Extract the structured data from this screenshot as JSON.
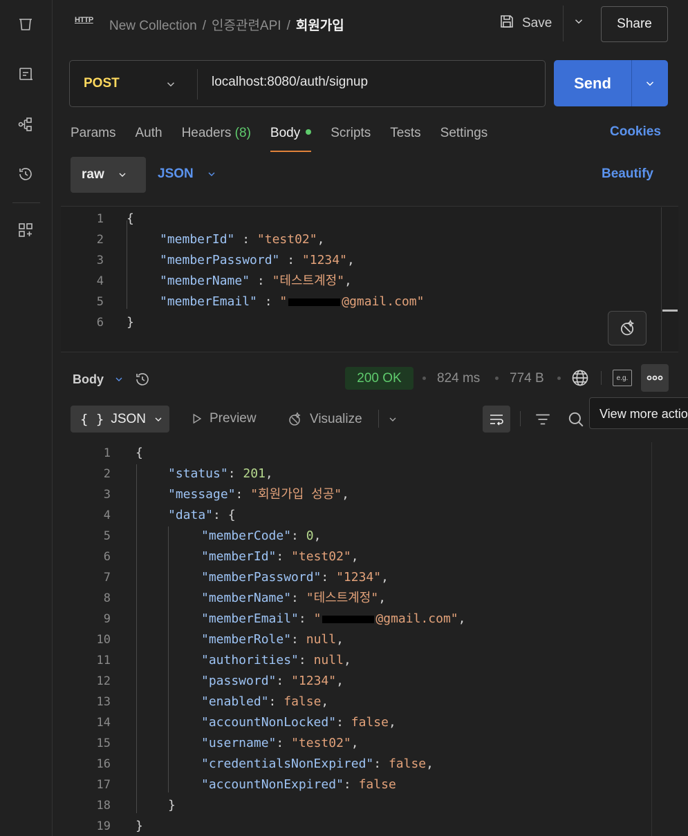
{
  "header": {
    "badge": "HTTP",
    "breadcrumb": [
      "New Collection",
      "인증관련API",
      "회원가입"
    ],
    "crumb_sep": "/",
    "save_label": "Save",
    "share_label": "Share"
  },
  "request": {
    "method": "POST",
    "url": "localhost:8080/auth/signup",
    "send_label": "Send"
  },
  "tabs": {
    "params": "Params",
    "auth": "Auth",
    "headers": "Headers",
    "headers_count": "(8)",
    "body": "Body",
    "scripts": "Scripts",
    "tests": "Tests",
    "settings": "Settings",
    "cookies": "Cookies"
  },
  "body_mode": {
    "raw": "raw",
    "json": "JSON",
    "beautify": "Beautify"
  },
  "request_body": {
    "line_numbers": [
      "1",
      "2",
      "3",
      "4",
      "5",
      "6"
    ],
    "open": "{",
    "close": "}",
    "fields": [
      {
        "key": "\"memberId\"",
        "value": "\"test02\"",
        "comma": ","
      },
      {
        "key": "\"memberPassword\"",
        "value": "\"1234\"",
        "comma": ","
      },
      {
        "key": "\"memberName\"",
        "value": "\"테스트계정\"",
        "comma": ","
      }
    ],
    "email_key": "\"memberEmail\"",
    "email_prefix": "\"",
    "email_suffix": "@gmail.com\""
  },
  "response": {
    "body_label": "Body",
    "status": "200 OK",
    "time": "824 ms",
    "size": "774 B",
    "eg_label": "e.g.",
    "tooltip": "View more actions",
    "format_label": "JSON",
    "format_braces": "{ }",
    "preview_label": "Preview",
    "visualize_label": "Visualize"
  },
  "response_body": {
    "line_numbers": [
      "1",
      "2",
      "3",
      "4",
      "5",
      "6",
      "7",
      "8",
      "9",
      "10",
      "11",
      "12",
      "13",
      "14",
      "15",
      "16",
      "17",
      "18",
      "19"
    ],
    "open": "{",
    "close": "}",
    "status_key": "\"status\"",
    "status_val": "201",
    "message_key": "\"message\"",
    "message_val": "\"회원가입 성공\"",
    "data_key": "\"data\"",
    "data_fields": [
      {
        "key": "\"memberCode\"",
        "value": "0",
        "type": "num",
        "comma": ","
      },
      {
        "key": "\"memberId\"",
        "value": "\"test02\"",
        "type": "str",
        "comma": ","
      },
      {
        "key": "\"memberPassword\"",
        "value": "\"1234\"",
        "type": "str",
        "comma": ","
      },
      {
        "key": "\"memberName\"",
        "value": "\"테스트계정\"",
        "type": "str",
        "comma": ","
      },
      {
        "key": "\"memberEmail\"",
        "value": "EMAIL",
        "type": "email",
        "comma": ","
      },
      {
        "key": "\"memberRole\"",
        "value": "null",
        "type": "lit",
        "comma": ","
      },
      {
        "key": "\"authorities\"",
        "value": "null",
        "type": "lit",
        "comma": ","
      },
      {
        "key": "\"password\"",
        "value": "\"1234\"",
        "type": "str",
        "comma": ","
      },
      {
        "key": "\"enabled\"",
        "value": "false",
        "type": "lit",
        "comma": ","
      },
      {
        "key": "\"accountNonLocked\"",
        "value": "false",
        "type": "lit",
        "comma": ","
      },
      {
        "key": "\"username\"",
        "value": "\"test02\"",
        "type": "str",
        "comma": ","
      },
      {
        "key": "\"credentialsNonExpired\"",
        "value": "false",
        "type": "lit",
        "comma": ","
      },
      {
        "key": "\"accountNonExpired\"",
        "value": "false",
        "type": "lit",
        "comma": ""
      }
    ],
    "email_prefix": "\"",
    "email_suffix": "@gmail.com\""
  },
  "colors": {
    "accent": "#3b6fd6",
    "method": "#ffd95e",
    "link": "#5b93ee",
    "ok": "#5fcb6d",
    "tab_underline": "#e0823a"
  },
  "icons": [
    "collections-icon",
    "environments-icon",
    "flows-icon",
    "history-icon",
    "apps-icon",
    "save-icon",
    "chevron-down-icon",
    "globe-icon",
    "more-icon",
    "magic-icon",
    "wrap-icon",
    "filter-icon",
    "search-icon",
    "play-icon",
    "visualize-icon",
    "history-icon"
  ]
}
